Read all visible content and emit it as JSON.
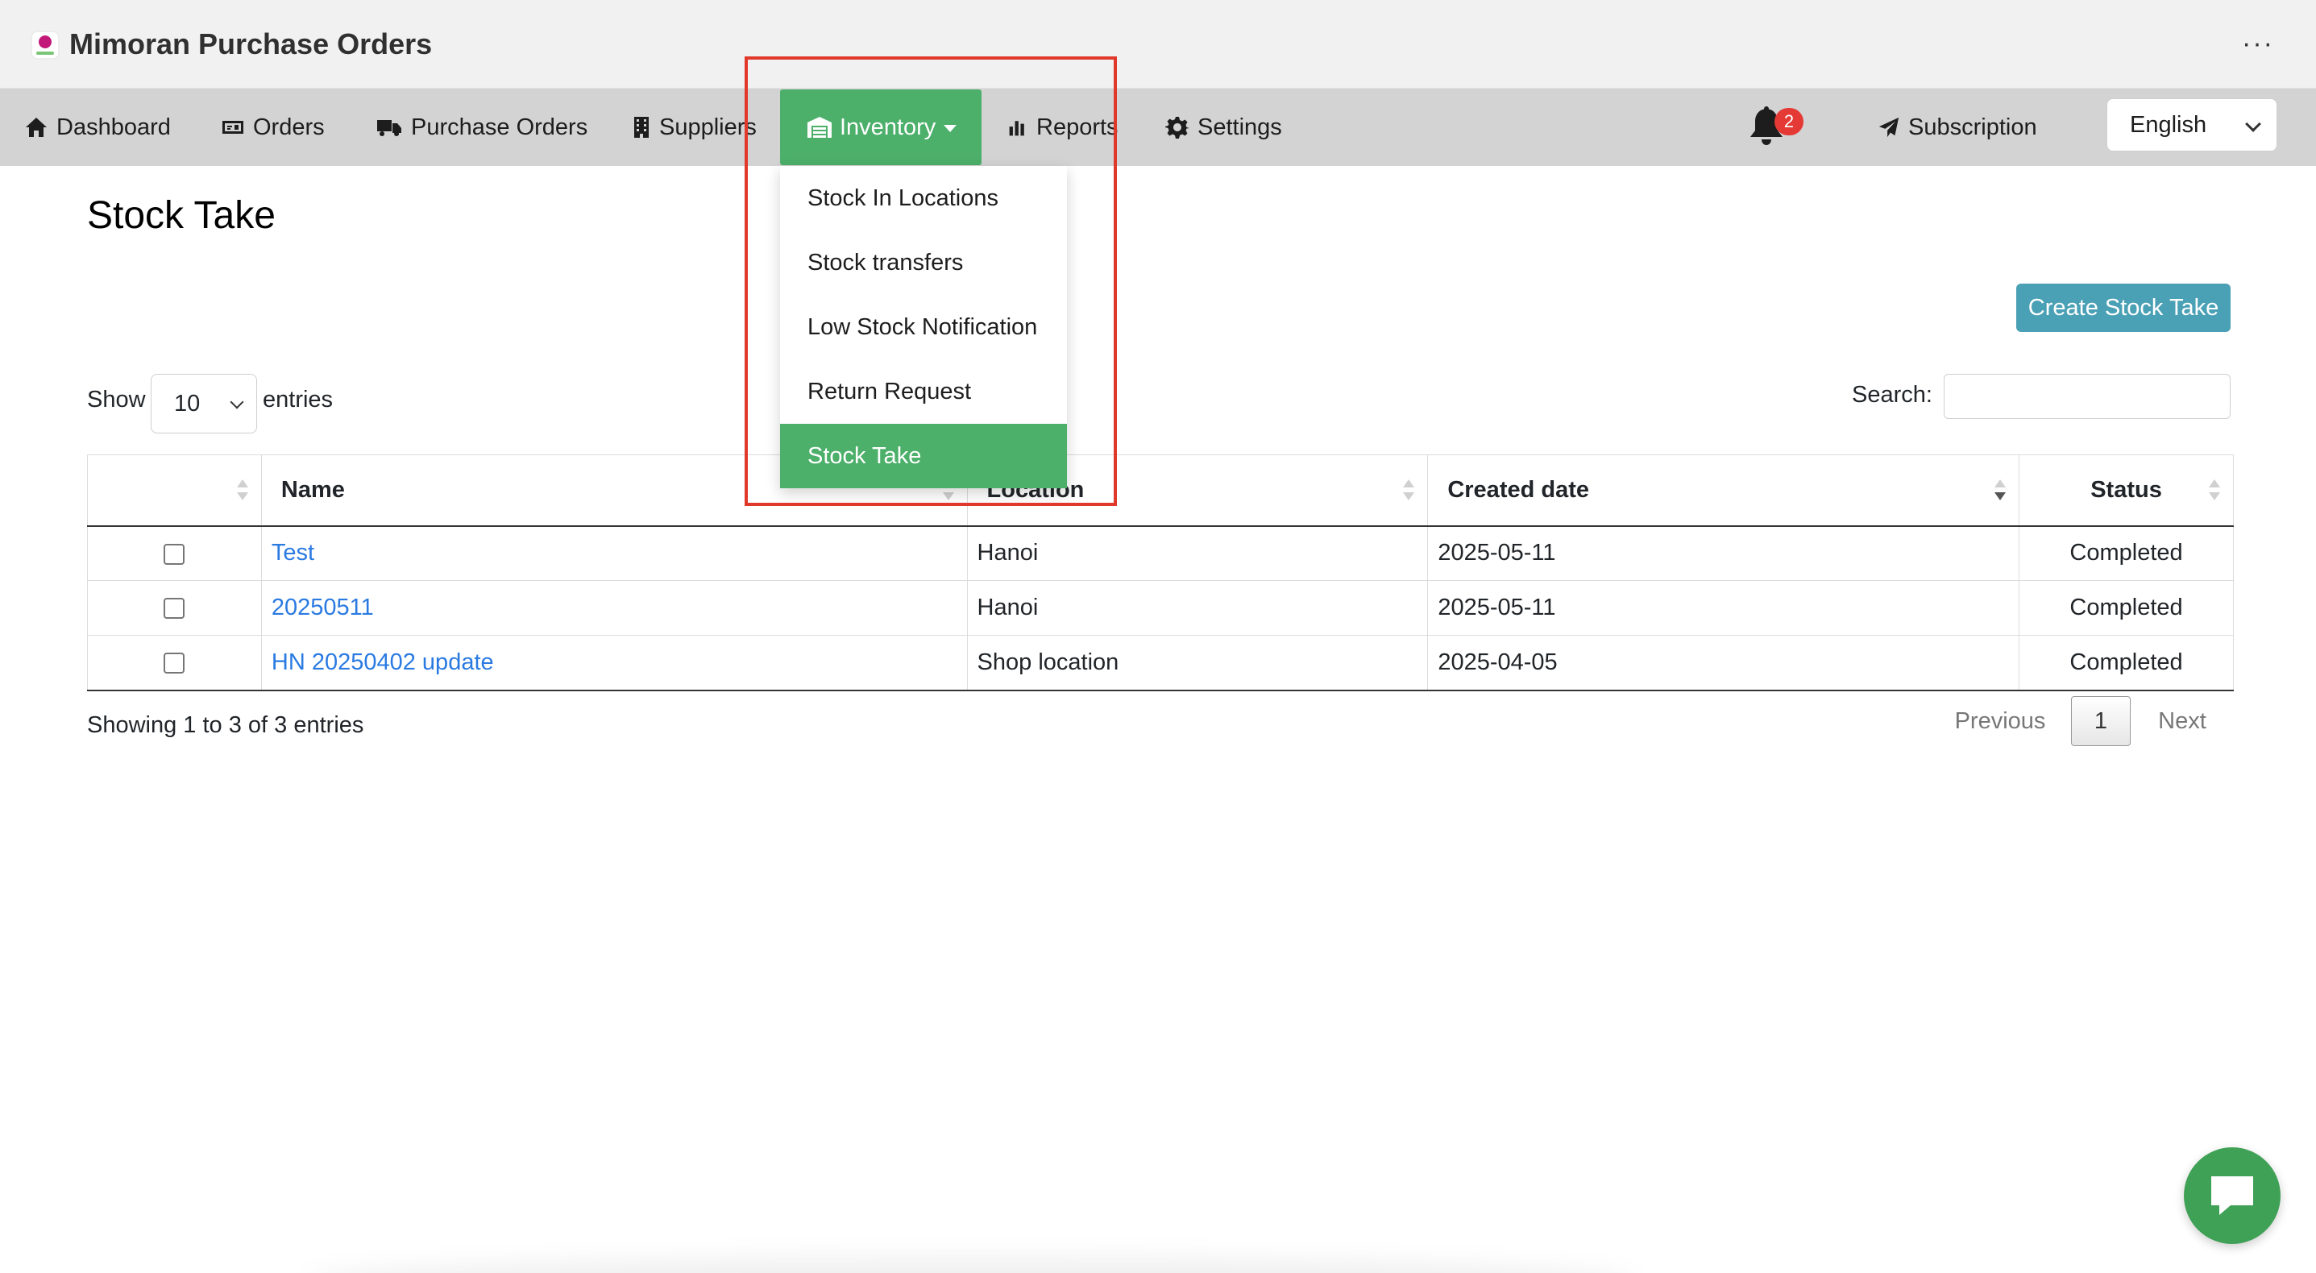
{
  "app": {
    "title": "Mimoran Purchase Orders",
    "more_label": "···"
  },
  "nav": {
    "dashboard": "Dashboard",
    "orders": "Orders",
    "purchase_orders": "Purchase Orders",
    "suppliers": "Suppliers",
    "inventory": "Inventory",
    "reports": "Reports",
    "settings": "Settings",
    "notification_count": "2",
    "subscription": "Subscription",
    "language": "English"
  },
  "inventory_menu": {
    "items": [
      {
        "label": "Stock In Locations"
      },
      {
        "label": "Stock transfers"
      },
      {
        "label": "Low Stock Notification"
      },
      {
        "label": "Return Request"
      },
      {
        "label": "Stock Take"
      }
    ]
  },
  "page": {
    "title": "Stock Take",
    "create_button": "Create Stock Take"
  },
  "table_controls": {
    "show_label": "Show",
    "page_length": "10",
    "entries_label": "entries",
    "search_label": "Search:",
    "search_value": ""
  },
  "table": {
    "columns": [
      "Name",
      "Location",
      "Created date",
      "Status"
    ],
    "rows": [
      {
        "name": "Test",
        "location": "Hanoi",
        "created": "2025-05-11",
        "status": "Completed"
      },
      {
        "name": "20250511",
        "location": "Hanoi",
        "created": "2025-05-11",
        "status": "Completed"
      },
      {
        "name": "HN 20250402 update",
        "location": "Shop location",
        "created": "2025-04-05",
        "status": "Completed"
      }
    ]
  },
  "footer": {
    "info": "Showing 1 to 3 of 3 entries",
    "previous": "Previous",
    "current_page": "1",
    "next": "Next"
  },
  "colors": {
    "nav_active": "#4caf6a",
    "primary_button": "#4aa0b5",
    "link": "#2a7ae2",
    "highlight": "#e0392b"
  }
}
